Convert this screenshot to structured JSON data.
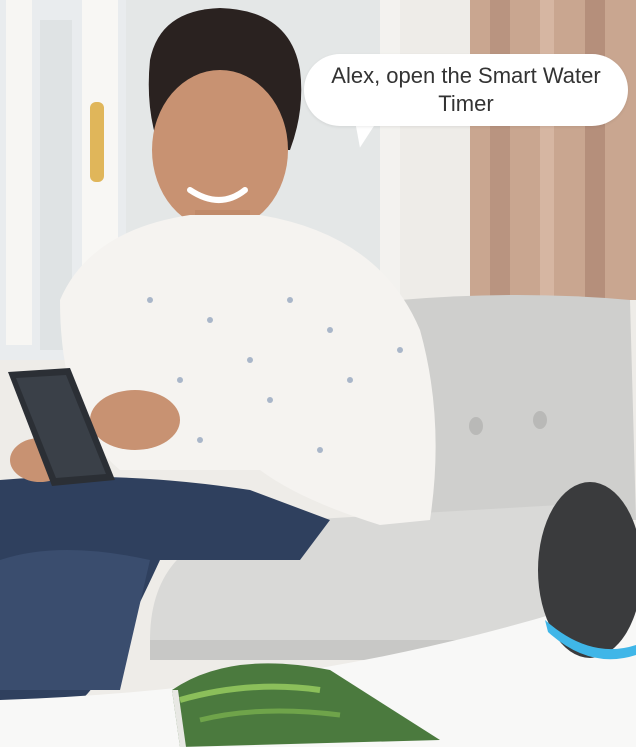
{
  "speech_bubble": {
    "text": "Alex, open the Smart Water Timer"
  },
  "scene": {
    "icons": [
      "woman-icon",
      "tablet-icon",
      "smart-speaker-icon",
      "sofa-icon",
      "magazine-icon"
    ],
    "colors": {
      "window_frame": "#f2f0ec",
      "curtain": "#c8a48e",
      "sofa": "#d8d8d6",
      "shirt": "#f5f3f0",
      "jeans": "#2e3f5c",
      "speaker": "#3a3b3d",
      "speaker_light": "#3fb6e8",
      "table": "#f7f7f6"
    }
  }
}
